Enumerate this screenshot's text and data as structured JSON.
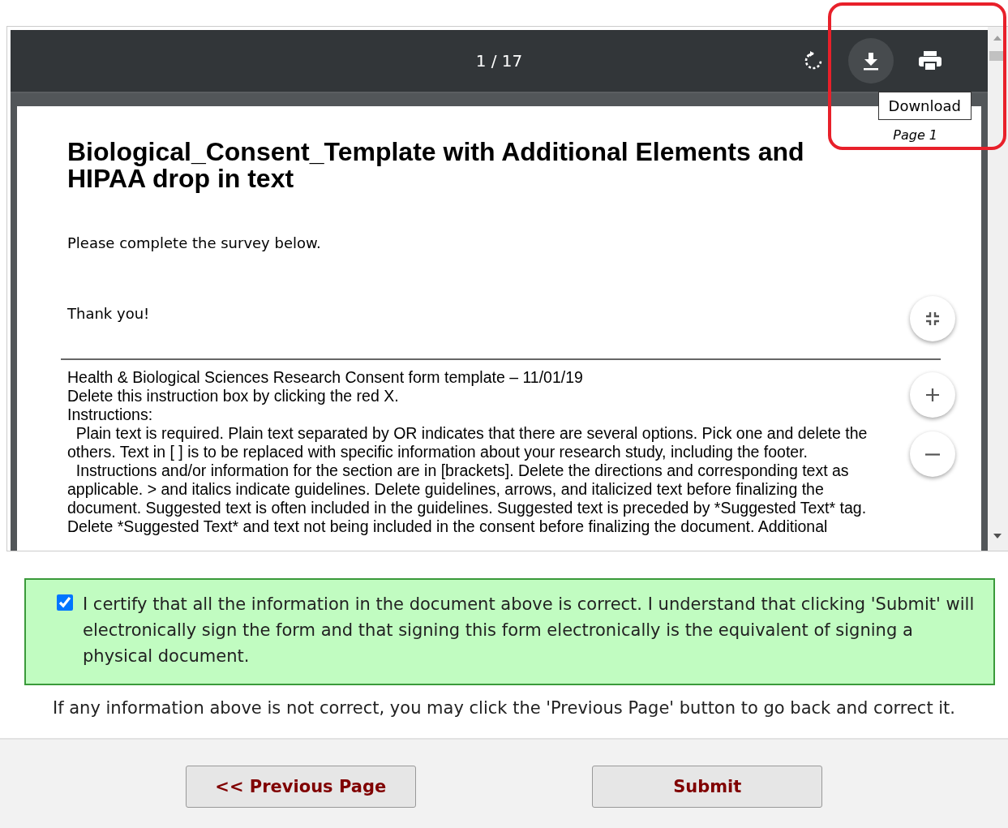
{
  "viewer": {
    "page_indicator": "1 / 17",
    "tooltip": "Download",
    "page_label": "Page 1",
    "document": {
      "title": "Biological_Consent_Template with Additional Elements and HIPAA drop in text",
      "intro": "Please complete the survey below.",
      "thanks": "Thank you!",
      "instructions": [
        "Health & Biological Sciences Research Consent form template – 11/01/19",
        "Delete this instruction box by clicking the red X.",
        "Instructions:",
        "  Plain text is required. Plain text separated by OR indicates that there are several options. Pick one and delete the",
        "others. Text in [ ] is to be replaced with specific information about your research study, including the footer.",
        "  Instructions and/or information for the section are in [brackets]. Delete the directions and corresponding text as",
        "applicable. > and italics indicate guidelines. Delete guidelines, arrows, and italicized text before finalizing the",
        "document. Suggested text is often included in the guidelines. Suggested text is preceded by *Suggested Text* tag.",
        "Delete *Suggested Text* and text not being included in the consent before finalizing the document. Additional"
      ]
    }
  },
  "certification": {
    "checked": true,
    "text": "I certify that all the information in the document above is correct. I understand that clicking 'Submit' will electronically sign the form and that signing this form electronically is the equivalent of signing a physical document."
  },
  "note": "If any information above is not correct, you may click the 'Previous Page' button to go back and correct it.",
  "buttons": [
    "<< Previous Page",
    "Submit"
  ]
}
